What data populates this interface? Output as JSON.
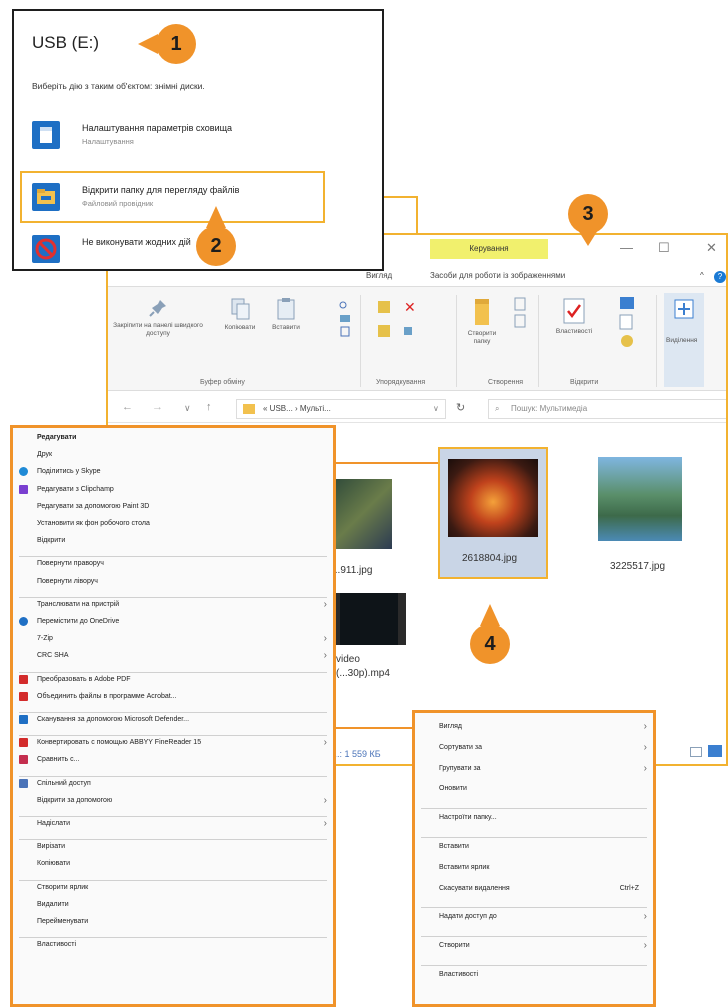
{
  "autoplay": {
    "title": "USB (E:)",
    "subtitle": "Виберіть дію з таким об'єктом: знімні диски.",
    "items": [
      {
        "title": "Налаштування параметрів сховища",
        "sub": "Налаштування",
        "icon": "storage-settings-icon"
      },
      {
        "title": "Відкрити папку для перегляду файлів",
        "sub": "Файловий провідник",
        "icon": "folder-explorer-icon"
      },
      {
        "title": "Не виконувати жодних дій",
        "sub": "",
        "icon": "no-action-icon"
      }
    ]
  },
  "badges": {
    "b1": "1",
    "b2": "2",
    "b3": "3",
    "b4": "4"
  },
  "explorer": {
    "tool_tab": "Керування",
    "ribbon_tabs": {
      "view": "Вигляд",
      "picture_tools": "Засоби для роботи із зображеннями"
    },
    "ribbon": {
      "pin": "Закріпити на панелі швидкого доступу",
      "copy": "Копіювати",
      "paste": "Вставити",
      "new_folder": "Створити папку",
      "properties": "Властивості",
      "select": "Виділення",
      "groups": {
        "clipboard": "Буфер обміну",
        "organize": "Упорядкування",
        "new": "Створення",
        "open": "Відкрити"
      }
    },
    "address": "« USB... › Мульті...",
    "search_placeholder": "Пошук: Мультимедіа",
    "files": [
      {
        "name": "...911.jpg"
      },
      {
        "name": "2618804.jpg"
      },
      {
        "name": "3225517.jpg"
      },
      {
        "name": "video (...30p).mp4"
      }
    ],
    "status": "...: 1  559 КБ"
  },
  "context_file": {
    "items": [
      {
        "label": "Редагувати",
        "bold": true
      },
      {
        "label": "Друк"
      },
      {
        "label": "Поділитись у Skype",
        "icon": "skype-icon"
      },
      {
        "label": "Редагувати з Clipchamp",
        "icon": "clipchamp-icon"
      },
      {
        "label": "Редагувати за допомогою Paint 3D"
      },
      {
        "label": "Установити як фон робочого стола"
      },
      {
        "label": "Відкрити"
      },
      {
        "label": "Повернути праворуч"
      },
      {
        "label": "Повернути ліворуч"
      },
      {
        "label": "Транслювати на пристрій",
        "submenu": true
      },
      {
        "label": "Перемістити до OneDrive",
        "icon": "onedrive-icon"
      },
      {
        "label": "7-Zip",
        "submenu": true
      },
      {
        "label": "CRC SHA",
        "submenu": true
      },
      {
        "label": "Преобразовать в Adobe PDF",
        "icon": "adobe-pdf-icon"
      },
      {
        "label": "Объединить файлы в программе Acrobat...",
        "icon": "acrobat-icon"
      },
      {
        "label": "Сканування за допомогою Microsoft Defender...",
        "icon": "defender-icon"
      },
      {
        "label": "Конвертировать с помощью ABBYY FineReader 15",
        "icon": "abbyy-icon",
        "submenu": true
      },
      {
        "label": "Сравнить с...",
        "icon": "compare-icon"
      },
      {
        "label": "Спільний доступ",
        "icon": "share-icon"
      },
      {
        "label": "Відкрити за допомогою",
        "submenu": true
      },
      {
        "label": "Надіслати",
        "submenu": true
      },
      {
        "label": "Вирізати"
      },
      {
        "label": "Копіювати"
      },
      {
        "label": "Створити ярлик"
      },
      {
        "label": "Видалити"
      },
      {
        "label": "Перейменувати"
      },
      {
        "label": "Властивості"
      }
    ]
  },
  "context_folder": {
    "items": [
      {
        "label": "Вигляд",
        "submenu": true
      },
      {
        "label": "Сортувати за",
        "submenu": true
      },
      {
        "label": "Групувати за",
        "submenu": true
      },
      {
        "label": "Оновити"
      },
      {
        "label": "Настроїти папку..."
      },
      {
        "label": "Вставити"
      },
      {
        "label": "Вставити ярлик"
      },
      {
        "label": "Скасувати видалення",
        "shortcut": "Ctrl+Z"
      },
      {
        "label": "Надати доступ до",
        "submenu": true
      },
      {
        "label": "Створити",
        "submenu": true
      },
      {
        "label": "Властивості"
      }
    ]
  },
  "colors": {
    "accent_orange": "#f0932a",
    "highlight_yellow": "#f2b230",
    "tool_tab": "#f1f06d"
  }
}
